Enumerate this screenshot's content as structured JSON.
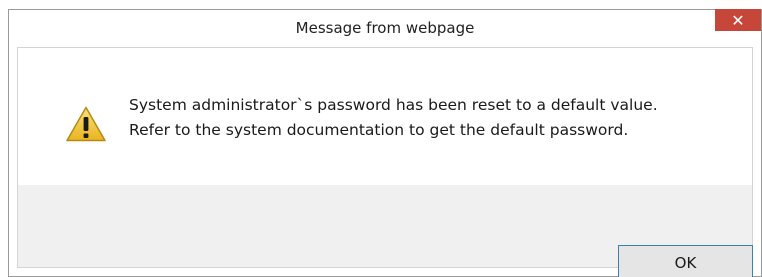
{
  "dialog": {
    "title": "Message from webpage",
    "close_label": "✕",
    "message_lines": [
      "System administrator`s password has been reset to a default value.",
      "Refer to the system documentation to get the default password."
    ],
    "ok_label": "OK",
    "icon": "warning-icon"
  },
  "colors": {
    "close_bg": "#c7463a",
    "ok_border": "#3c7fb1",
    "footer_bg": "#f0f0f0"
  }
}
